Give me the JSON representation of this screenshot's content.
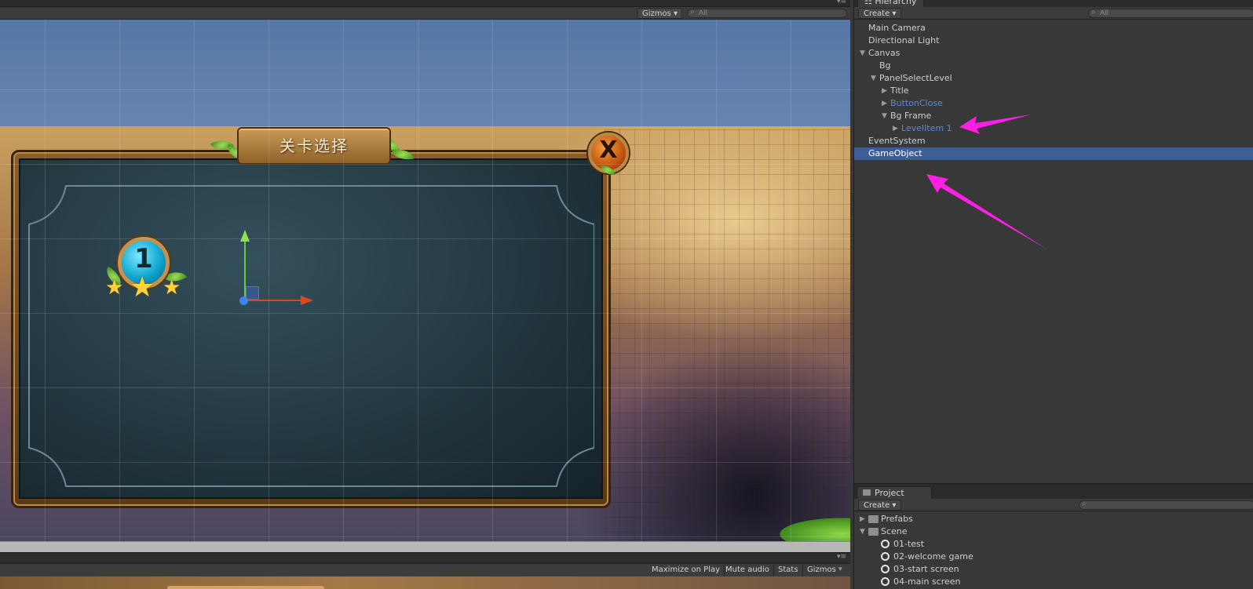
{
  "scene": {
    "gizmos_label": "Gizmos ▾",
    "search_placeholder": "All",
    "game_title": "关卡选择",
    "close_glyph": "X",
    "level_number": "1"
  },
  "game_toolbar": {
    "maximize_label": "Maximize on Play",
    "mute_label": "Mute audio",
    "stats_label": "Stats",
    "gizmos_label": "Gizmos"
  },
  "hierarchy": {
    "tab_label": "Hierarchy",
    "create_label": "Create ▾",
    "search_placeholder": "All",
    "items": [
      {
        "label": "Main Camera",
        "depth": 0,
        "expander": "",
        "prefab": false,
        "selected": false
      },
      {
        "label": "Directional Light",
        "depth": 0,
        "expander": "",
        "prefab": false,
        "selected": false
      },
      {
        "label": "Canvas",
        "depth": 0,
        "expander": "open",
        "prefab": false,
        "selected": false
      },
      {
        "label": "Bg",
        "depth": 1,
        "expander": "",
        "prefab": false,
        "selected": false
      },
      {
        "label": "PanelSelectLevel",
        "depth": 1,
        "expander": "open",
        "prefab": false,
        "selected": false
      },
      {
        "label": "Title",
        "depth": 2,
        "expander": "closed",
        "prefab": false,
        "selected": false
      },
      {
        "label": "ButtonClose",
        "depth": 2,
        "expander": "closed",
        "prefab": true,
        "selected": false
      },
      {
        "label": "Bg Frame",
        "depth": 2,
        "expander": "open",
        "prefab": false,
        "selected": false
      },
      {
        "label": "LevelItem 1",
        "depth": 3,
        "expander": "closed",
        "prefab": true,
        "selected": false
      },
      {
        "label": "EventSystem",
        "depth": 0,
        "expander": "",
        "prefab": false,
        "selected": false
      },
      {
        "label": "GameObject",
        "depth": 0,
        "expander": "",
        "prefab": false,
        "selected": true
      }
    ]
  },
  "project": {
    "tab_label": "Project",
    "create_label": "Create ▾",
    "items": [
      {
        "label": "Prefabs",
        "kind": "folder",
        "expander": "closed",
        "depth": 0
      },
      {
        "label": "Scene",
        "kind": "folder",
        "expander": "open",
        "depth": 0
      },
      {
        "label": "01-test",
        "kind": "scene",
        "expander": "",
        "depth": 1
      },
      {
        "label": "02-welcome game",
        "kind": "scene",
        "expander": "",
        "depth": 1
      },
      {
        "label": "03-start screen",
        "kind": "scene",
        "expander": "",
        "depth": 1
      },
      {
        "label": "04-main screen",
        "kind": "scene",
        "expander": "",
        "depth": 1
      }
    ]
  },
  "colors": {
    "selection": "#3e5f96",
    "prefab_text": "#5b8ad6",
    "annotation_arrow": "#ff1fe6"
  }
}
